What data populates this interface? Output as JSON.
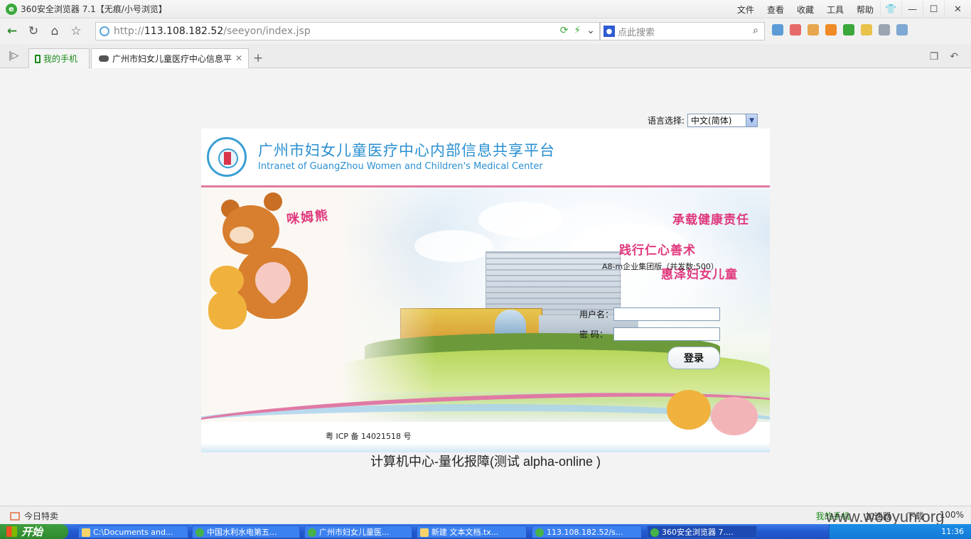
{
  "window": {
    "title": "360安全浏览器 7.1【无痕/小号浏览】",
    "menu": [
      "文件",
      "查看",
      "收藏",
      "工具",
      "帮助"
    ]
  },
  "address": {
    "url_prefix": "http://",
    "url_host": "113.108.182.52",
    "url_path": "/seeyon/index.jsp",
    "search_placeholder": "点此搜索"
  },
  "tabs": [
    {
      "label": "我的手机"
    },
    {
      "label": "广州市妇女儿童医疗中心信息平"
    }
  ],
  "page": {
    "language_label": "语言选择:",
    "language_value": "中文(简体)",
    "title_cn": "广州市妇女儿童医疗中心内部信息共享平台",
    "title_en": "Intranet of GuangZhou Women and Children's Medical Center",
    "mascot_name": "咪姆熊",
    "slogan_1": "承载健康责任",
    "slogan_2": "践行仁心善术",
    "slogan_3": "惠泽妇女儿童",
    "edition": "A8-m企业集团版（并发数:500）",
    "username_label": "用户名：",
    "password_label": "密  码：",
    "login_button": "登录",
    "icp": "粤 ICP 备 14021518 号",
    "footer": "计算机中心-量化报障(测试 alpha-online )"
  },
  "statusbar": {
    "left": "今日特卖",
    "items": [
      "我的手机",
      "加速器",
      "下载",
      "100%"
    ]
  },
  "taskbar": {
    "start": "开始",
    "items": [
      "C:\\Documents and...",
      "中国水利水电第五...",
      "广州市妇女儿童医...",
      "新建 文本文档.tx...",
      "113.108.182.52/s...",
      "360安全浏览器 7...."
    ],
    "clock": "11:36"
  },
  "watermark": "www.wooyun.org"
}
